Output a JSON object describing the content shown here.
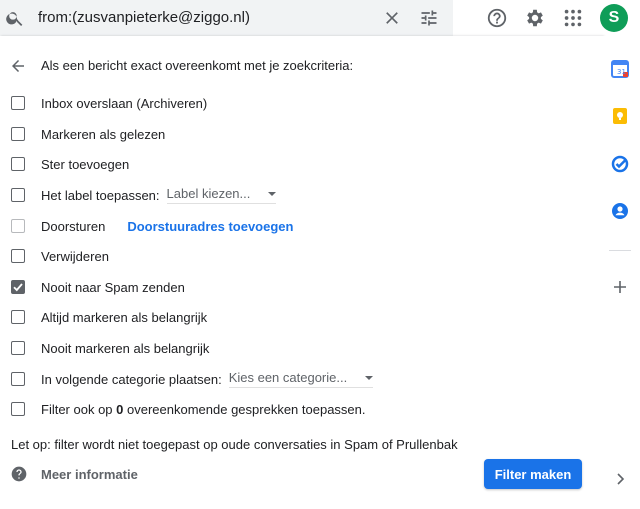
{
  "search": {
    "query": "from:(zusvanpieterke@ziggo.nl)"
  },
  "account": {
    "initial": "S",
    "color": "#0f9d58"
  },
  "filter": {
    "heading": "Als een bericht exact overeenkomt met je zoekcriteria:",
    "options": [
      {
        "label": "Inbox overslaan (Archiveren)",
        "checked": false
      },
      {
        "label": "Markeren als gelezen",
        "checked": false
      },
      {
        "label": "Ster toevoegen",
        "checked": false
      },
      {
        "label": "Het label toepassen:",
        "checked": false,
        "select": "Label kiezen..."
      },
      {
        "label": "Doorsturen",
        "checked": false,
        "disabled": true,
        "link": "Doorstuuradres toevoegen"
      },
      {
        "label": "Verwijderen",
        "checked": false
      },
      {
        "label": "Nooit naar Spam zenden",
        "checked": true
      },
      {
        "label": "Altijd markeren als belangrijk",
        "checked": false
      },
      {
        "label": "Nooit markeren als belangrijk",
        "checked": false
      },
      {
        "label": "In volgende categorie plaatsen:",
        "checked": false,
        "select": "Kies een categorie..."
      }
    ],
    "apply_also": {
      "prefix": "Filter ook op ",
      "count": "0",
      "suffix": " overeenkomende gesprekken toepassen.",
      "checked": false
    },
    "note": "Let op: filter wordt niet toegepast op oude conversaties in Spam of Prullenbak",
    "more_info": "Meer informatie",
    "create_button": "Filter maken"
  },
  "colors": {
    "accent": "#1a73e8"
  }
}
